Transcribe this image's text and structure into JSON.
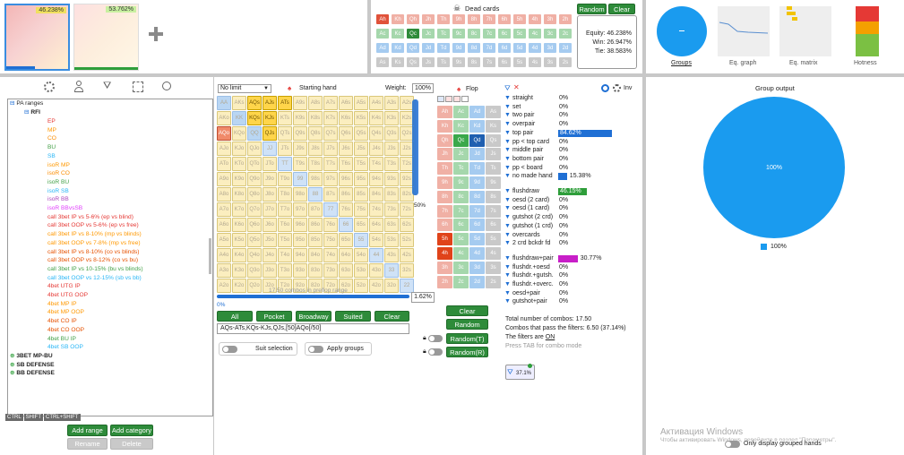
{
  "top": {
    "thumb1_pct": "46.238%",
    "thumb2_pct": "53.762%",
    "dead_title": "Dead cards",
    "dead_cards": [
      [
        "Ah",
        "Kh",
        "Qh",
        "Jh",
        "Th",
        "9h",
        "8h",
        "7h",
        "6h",
        "5h",
        "4h",
        "3h",
        "2h"
      ],
      [
        "Ac",
        "Kc",
        "Qc",
        "Jc",
        "Tc",
        "9c",
        "8c",
        "7c",
        "6c",
        "5c",
        "4c",
        "3c",
        "2c"
      ],
      [
        "Ad",
        "Kd",
        "Qd",
        "Jd",
        "Td",
        "9d",
        "8d",
        "7d",
        "6d",
        "5d",
        "4d",
        "3d",
        "2d"
      ],
      [
        "As",
        "Ks",
        "Qs",
        "Js",
        "Ts",
        "9s",
        "8s",
        "7s",
        "6s",
        "5s",
        "4s",
        "3s",
        "2s"
      ]
    ],
    "random_label": "Random",
    "clear_label": "Clear",
    "equity": "Equity: 46.238%",
    "win": "Win: 26.947%",
    "tie": "Tie: 38.583%",
    "tabs": [
      "Groups",
      "Eq. graph",
      "Eq. matrix",
      "Hotness"
    ]
  },
  "toolbar": {
    "icons": [
      "gear-icon",
      "user-icon",
      "filter-icon",
      "scan-icon",
      "search-icon"
    ]
  },
  "tree": {
    "root": "PA ranges",
    "rfi": "RFI",
    "items": [
      {
        "t": "EP",
        "c": "#e53935"
      },
      {
        "t": "MP",
        "c": "#ff9800"
      },
      {
        "t": "CO",
        "c": "#fb8c00"
      },
      {
        "t": "BU",
        "c": "#43a047"
      },
      {
        "t": "SB",
        "c": "#29b6f6"
      },
      {
        "t": "isoR MP",
        "c": "#ff9800"
      },
      {
        "t": "isoR CO",
        "c": "#fb8c00"
      },
      {
        "t": "isoR BU",
        "c": "#43a047"
      },
      {
        "t": "isoR SB",
        "c": "#29b6f6"
      },
      {
        "t": "isoR BB",
        "c": "#ab47bc"
      },
      {
        "t": "isoR BBvsSB",
        "c": "#e040fb"
      },
      {
        "t": "call 3bet IP vs 5-6% (ep vs blind)",
        "c": "#e53935"
      },
      {
        "t": "call 3bet OOP vs 5-6% (ep vs free)",
        "c": "#e53935"
      },
      {
        "t": "call 3bet IP vs 8-10% (mp vs blinds)",
        "c": "#ff9800"
      },
      {
        "t": "call 3bet OOP vs 7-8% (mp vs free)",
        "c": "#ff9800"
      },
      {
        "t": "call 3bet IP vs 8-10% (co vs blinds)",
        "c": "#e65100"
      },
      {
        "t": "call 3bet OOP vs 8-12% (co vs bu)",
        "c": "#e65100"
      },
      {
        "t": "call 3bet IP vs 10-15% (bu vs blinds)",
        "c": "#43a047"
      },
      {
        "t": "call 3bet OOP vs 12-15% (sb vs bb)",
        "c": "#29b6f6"
      },
      {
        "t": "4bet UTG IP",
        "c": "#e53935"
      },
      {
        "t": "4bet UTG OOP",
        "c": "#e53935"
      },
      {
        "t": "4bet MP IP",
        "c": "#ff9800"
      },
      {
        "t": "4bet MP OOP",
        "c": "#ff9800"
      },
      {
        "t": "4bet CO IP",
        "c": "#e65100"
      },
      {
        "t": "4bet CO OOP",
        "c": "#e65100"
      },
      {
        "t": "4bet BU IP",
        "c": "#43a047"
      },
      {
        "t": "4bet SB OOP",
        "c": "#29b6f6"
      }
    ],
    "groups": [
      "3BET MP-BU",
      "SB DEFENSE",
      "BB DEFENSE"
    ],
    "keys": [
      "CTRL",
      "SHIFT",
      "CTRL+SHIFT"
    ],
    "add_range": "Add range",
    "add_category": "Add category",
    "rename": "Rename",
    "delete": "Delete"
  },
  "range": {
    "game_select": "No limit",
    "title": "Starting hand",
    "weight_label": "Weight:",
    "weight_value": "100%",
    "combos_text": "17.50 combos in preflop range",
    "slider_pct": "0%",
    "slider_value": "1.62%",
    "weight_pct_side": "50%",
    "buttons": [
      "All",
      "Pocket",
      "Broadway",
      "Suited",
      "Clear"
    ],
    "range_text": "AQs-ATs,KQs-KJs,QJs,[50]AQo[/50]",
    "suit_selection": "Suit selection",
    "apply_groups": "Apply groups",
    "ranks": [
      "A",
      "K",
      "Q",
      "J",
      "T",
      "9",
      "8",
      "7",
      "6",
      "5",
      "4",
      "3",
      "2"
    ],
    "selected": [
      "AQs",
      "AJs",
      "ATs",
      "KQs",
      "KJs",
      "QJs",
      "AQo"
    ]
  },
  "flop": {
    "title": "Flop",
    "clear": "Clear",
    "random": "Random",
    "random_t": "Random(T)",
    "random_r": "Random(R)",
    "cards": [
      [
        "Ah",
        "Ac",
        "Ad",
        "As"
      ],
      [
        "Kh",
        "Kc",
        "Kd",
        "Ks"
      ],
      [
        "Qh",
        "Qc",
        "Qd",
        "Qs"
      ],
      [
        "Jh",
        "Jc",
        "Jd",
        "Js"
      ],
      [
        "Th",
        "Tc",
        "Td",
        "Ts"
      ],
      [
        "9h",
        "9c",
        "9d",
        "9s"
      ],
      [
        "8h",
        "8c",
        "8d",
        "8s"
      ],
      [
        "7h",
        "7c",
        "7d",
        "7s"
      ],
      [
        "6h",
        "6c",
        "6d",
        "6s"
      ],
      [
        "5h",
        "5c",
        "5d",
        "5s"
      ],
      [
        "4h",
        "4c",
        "4d",
        "4s"
      ],
      [
        "3h",
        "3c",
        "3d",
        "3s"
      ],
      [
        "2h",
        "2c",
        "2d",
        "2s"
      ]
    ],
    "selected": [
      "Qc",
      "Qd",
      "5h",
      "4h"
    ]
  },
  "filters": {
    "inv": "Inv",
    "made": [
      {
        "l": "straight",
        "p": "0%"
      },
      {
        "l": "set",
        "p": "0%"
      },
      {
        "l": "two pair",
        "p": "0%"
      },
      {
        "l": "overpair",
        "p": "0%"
      },
      {
        "l": "top pair",
        "p": "84.62%",
        "bar": 0.85,
        "c": "#1f6fd4"
      },
      {
        "l": "pp < top card",
        "p": "0%"
      },
      {
        "l": "middle pair",
        "p": "0%"
      },
      {
        "l": "bottom pair",
        "p": "0%"
      },
      {
        "l": "pp < board",
        "p": "0%"
      },
      {
        "l": "no made hand",
        "p": "15.38%",
        "bar": 0.14,
        "c": "#1f6fd4"
      }
    ],
    "draws": [
      {
        "l": "flushdraw",
        "p": "46.15%",
        "bar": 0.46,
        "c": "#2e9e3a"
      },
      {
        "l": "oesd (2 card)",
        "p": "0%"
      },
      {
        "l": "oesd (1 card)",
        "p": "0%"
      },
      {
        "l": "gutshot (2 crd)",
        "p": "0%"
      },
      {
        "l": "gutshot (1 crd)",
        "p": "0%"
      },
      {
        "l": "overcards",
        "p": "0%"
      },
      {
        "l": "2 crd bckdr fd",
        "p": "0%"
      }
    ],
    "combo": [
      {
        "l": "flushdraw+pair",
        "p": "30.77%",
        "bar": 0.31,
        "c": "#c81fc8"
      },
      {
        "l": "flushdr.+oesd",
        "p": "0%"
      },
      {
        "l": "flushdr.+gutsh.",
        "p": "0%"
      },
      {
        "l": "flushdr.+overc.",
        "p": "0%"
      },
      {
        "l": "oesd+pair",
        "p": "0%"
      },
      {
        "l": "gutshot+pair",
        "p": "0%"
      }
    ],
    "total": "Total number of combos: 17.50",
    "pass": "Combos that pass the filters: 6.50 (37.14%)",
    "filters_on_prefix": "The filters are ",
    "filters_on": "ON",
    "tab_hint": "Press TAB for combo mode",
    "badge": "37.1%"
  },
  "group_output": {
    "title": "Group output",
    "center_label": "100%",
    "legend": "100%",
    "color": "#1a9bef"
  },
  "watermark": {
    "title": "Активация Windows",
    "sub": "Чтобы активировать Windows, перейдите в раздел \"Параметры\"."
  },
  "only_display_grouped": "Only display grouped hands"
}
